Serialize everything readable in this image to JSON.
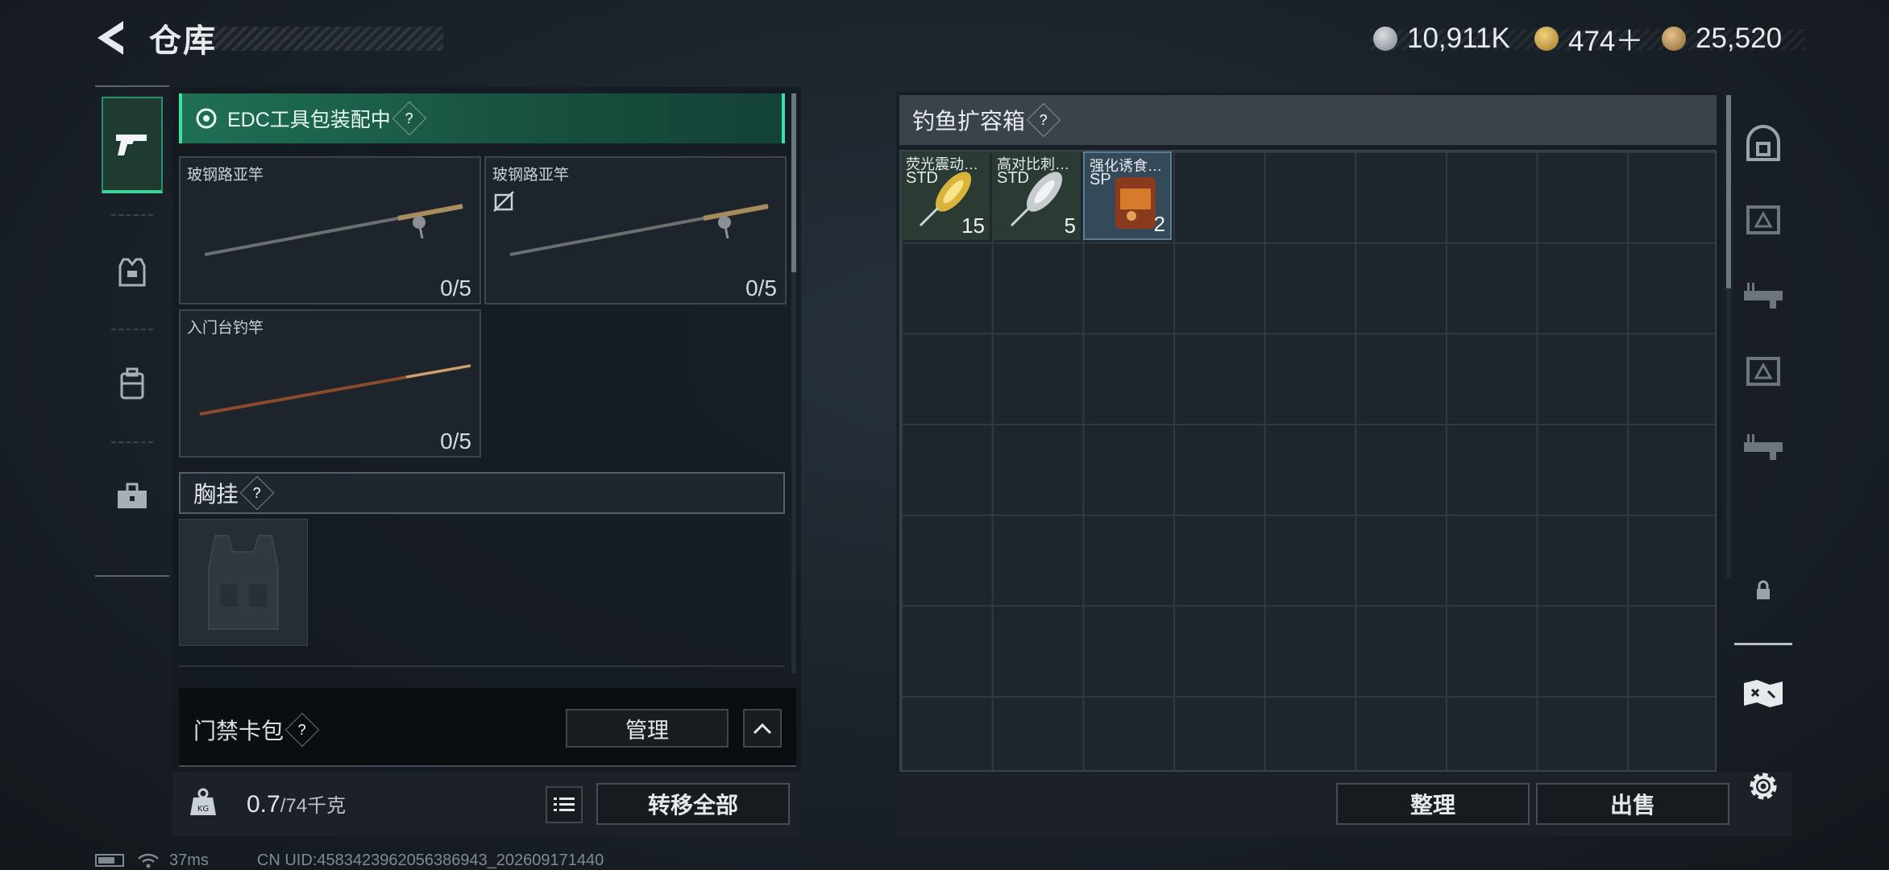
{
  "header": {
    "title": "仓库",
    "currencies": [
      {
        "icon": "silver-coin-icon",
        "value": "10,911K"
      },
      {
        "icon": "triangle-coin-icon",
        "value": "474＋"
      },
      {
        "icon": "gold-coin-icon",
        "value": "25,520"
      }
    ]
  },
  "left_tabs": [
    "pistol-icon",
    "armor-vest-icon",
    "backpack-icon",
    "toolbox-icon"
  ],
  "loadout": {
    "banner_label": "EDC工具包装配中",
    "banner_help": "?",
    "rods": [
      {
        "name": "玻钢路亚竿",
        "count": "0/5"
      },
      {
        "name": "玻钢路亚竿",
        "count": "0/5"
      },
      {
        "name": "入门台钓竿",
        "count": "0/5"
      }
    ],
    "chest_rig_label": "胸挂",
    "chest_rig_help": "?"
  },
  "keycard": {
    "label": "门禁卡包",
    "help": "?",
    "manage_label": "管理"
  },
  "weight": {
    "current": "0.7",
    "capacity": "/74千克"
  },
  "buttons": {
    "transfer_all": "转移全部",
    "sort": "整理",
    "sell": "出售"
  },
  "container": {
    "title": "钓鱼扩容箱",
    "help": "?",
    "items": [
      {
        "name": "荧光震动…",
        "grade": "STD",
        "qty": "15"
      },
      {
        "name": "高对比刺…",
        "grade": "STD",
        "qty": "5"
      },
      {
        "name": "强化诱食…",
        "grade": "SP",
        "qty": "2"
      }
    ]
  },
  "right_tabs": [
    "safebox-icon",
    "crate-icon",
    "rifle-case-icon",
    "crate-icon",
    "rifle-case-icon",
    "lock-icon"
  ],
  "status": {
    "ping": "37ms",
    "uid": "CN UID:4583423962056386943_202609171440"
  },
  "colors": {
    "accent_green": "#3fd19a",
    "banner_green": "#1f6f55"
  }
}
